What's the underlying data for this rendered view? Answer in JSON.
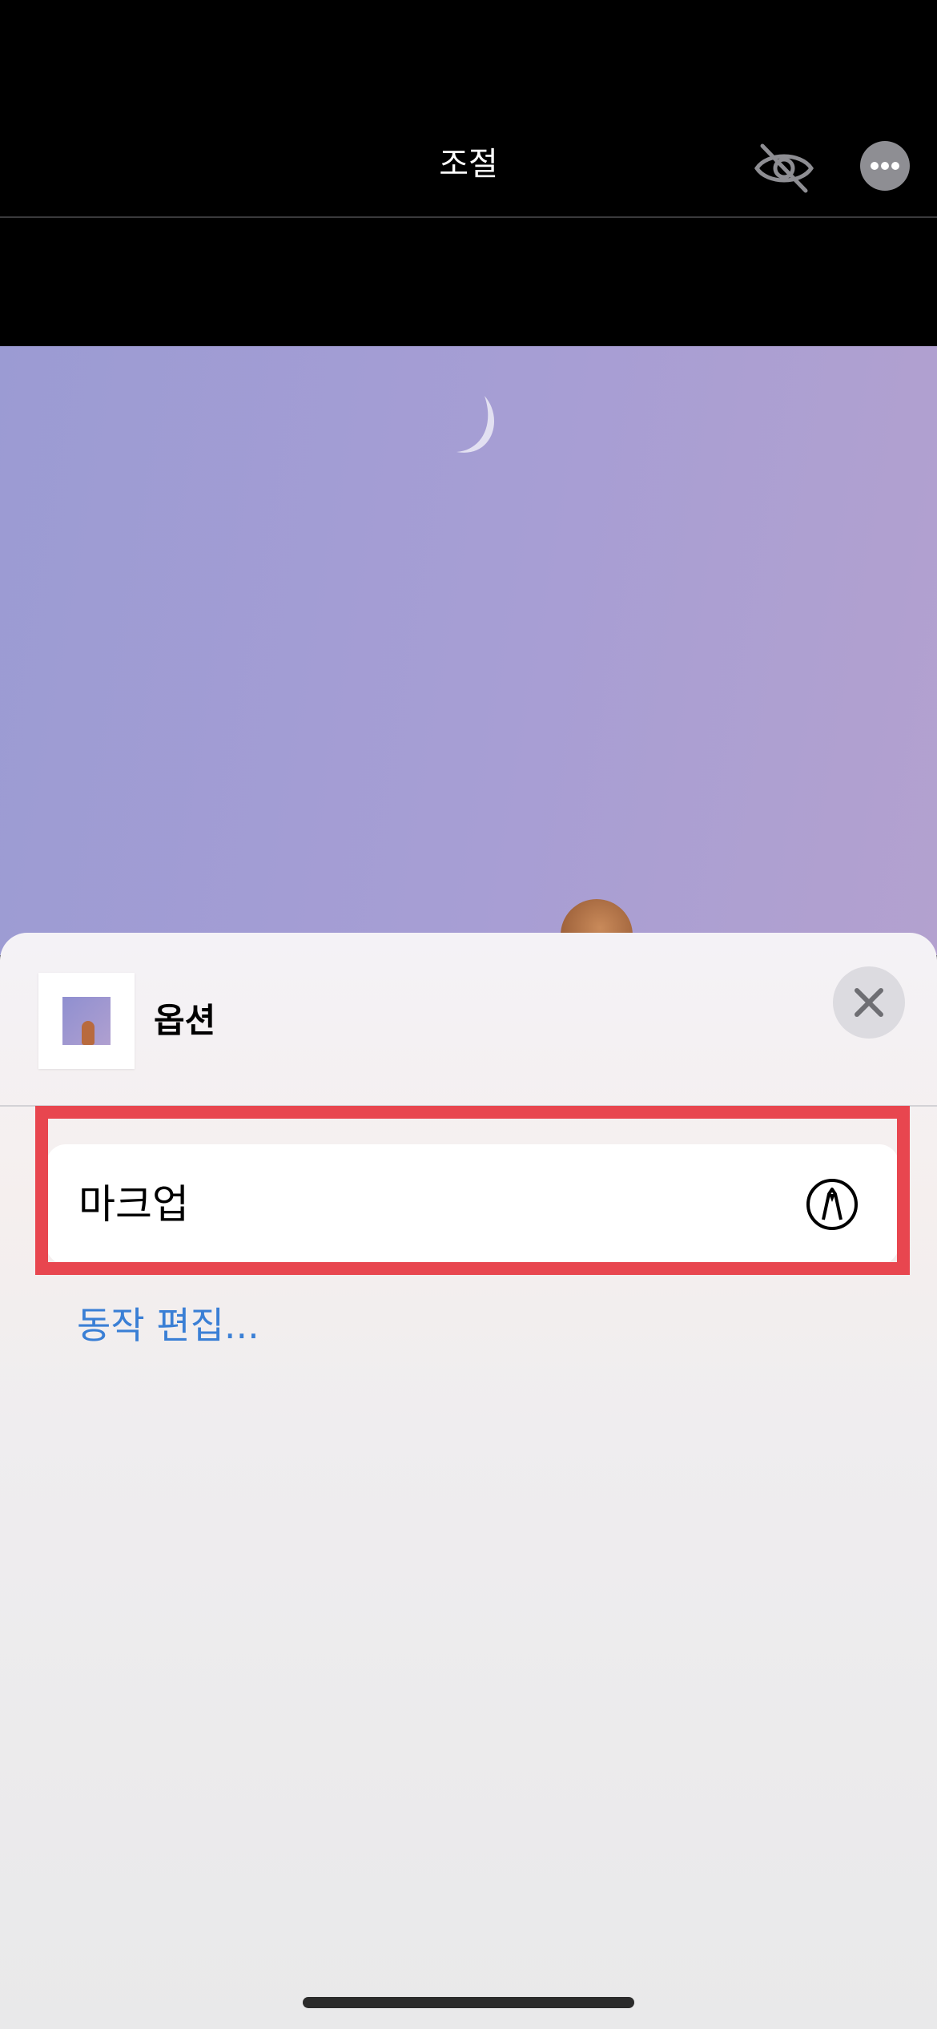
{
  "header": {
    "title": "조절",
    "hide_icon": "eye-slash-icon",
    "more_icon": "ellipsis-icon"
  },
  "sheet": {
    "title": "옵션",
    "close_icon": "close-icon",
    "actions": [
      {
        "label": "마크업",
        "icon": "markup-pen-icon"
      }
    ],
    "edit_actions_label": "동작 편집..."
  },
  "colors": {
    "highlight": "#e8464f",
    "link": "#3a7fd5"
  }
}
